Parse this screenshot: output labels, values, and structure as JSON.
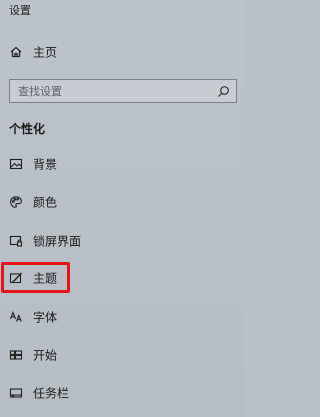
{
  "window": {
    "title": "设置"
  },
  "home": {
    "label": "主页",
    "icon": "home-icon"
  },
  "search": {
    "placeholder": "查找设置",
    "icon": "search-icon"
  },
  "section": {
    "title": "个性化"
  },
  "nav": {
    "items": [
      {
        "label": "背景",
        "icon": "image-icon"
      },
      {
        "label": "颜色",
        "icon": "palette-icon"
      },
      {
        "label": "锁屏界面",
        "icon": "lock-screen-icon"
      },
      {
        "label": "主题",
        "icon": "theme-brush-icon"
      },
      {
        "label": "字体",
        "icon": "font-icon"
      },
      {
        "label": "开始",
        "icon": "start-grid-icon"
      },
      {
        "label": "任务栏",
        "icon": "taskbar-icon"
      }
    ]
  },
  "highlight": {
    "target": "主题",
    "color": "#e3151b"
  }
}
